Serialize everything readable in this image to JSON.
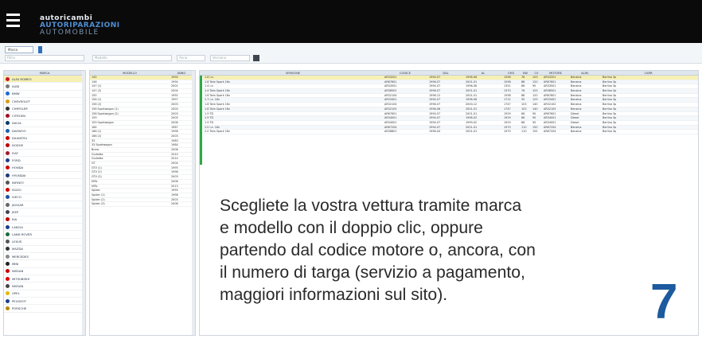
{
  "header": {
    "menu_icon": "hamburger-icon",
    "logo_line1": "autoricambi",
    "logo_line2": "AUTORIPARAZIONI",
    "logo_line3": "AUTOMOBILE"
  },
  "toolbar": {
    "selector_value": "Marca",
    "filter_brand_placeholder": "Filtra",
    "filter_model_placeholder": "Modello",
    "filter_year_placeholder": "Anno",
    "filter_version_placeholder": "Versione",
    "clear_icon": "clear-filter-icon"
  },
  "columns": {
    "brand": "MARCA",
    "model": "MODELLO",
    "year": "ANNO",
    "version": "VERSIONE",
    "code": "CODICE",
    "from": "DAL",
    "to": "AL",
    "cc": "CM3",
    "kw": "KW",
    "cv": "CV",
    "engine": "MOTORE",
    "fuel": "ALIM.",
    "body": "CARR."
  },
  "brands": [
    {
      "name": "ALFA ROMEO",
      "color": "#c8102e"
    },
    {
      "name": "AUDI",
      "color": "#777"
    },
    {
      "name": "BMW",
      "color": "#1c69d4"
    },
    {
      "name": "CHEVROLET",
      "color": "#d4a017"
    },
    {
      "name": "CHRYSLER",
      "color": "#333"
    },
    {
      "name": "CITROEN",
      "color": "#a40e26"
    },
    {
      "name": "DACIA",
      "color": "#0a3a6b"
    },
    {
      "name": "DAEWOO",
      "color": "#1b5fa8"
    },
    {
      "name": "DAIHATSU",
      "color": "#c00"
    },
    {
      "name": "DODGE",
      "color": "#b00"
    },
    {
      "name": "FIAT",
      "color": "#9b1b30"
    },
    {
      "name": "FORD",
      "color": "#1f3b8a"
    },
    {
      "name": "HONDA",
      "color": "#c00"
    },
    {
      "name": "HYUNDAI",
      "color": "#1e3a78"
    },
    {
      "name": "INFINITI",
      "color": "#555"
    },
    {
      "name": "ISUZU",
      "color": "#c00"
    },
    {
      "name": "IVECO",
      "color": "#1b4f9c"
    },
    {
      "name": "JAGUAR",
      "color": "#666"
    },
    {
      "name": "JEEP",
      "color": "#445"
    },
    {
      "name": "KIA",
      "color": "#b00"
    },
    {
      "name": "LANCIA",
      "color": "#1b3f8a"
    },
    {
      "name": "LAND ROVER",
      "color": "#1d6b3a"
    },
    {
      "name": "LEXUS",
      "color": "#555"
    },
    {
      "name": "MAZDA",
      "color": "#333"
    },
    {
      "name": "MERCEDES",
      "color": "#888"
    },
    {
      "name": "MINI",
      "color": "#222"
    },
    {
      "name": "NISSAN",
      "color": "#c00"
    },
    {
      "name": "MITSUBISHI",
      "color": "#d00"
    },
    {
      "name": "NISSAN",
      "color": "#444"
    },
    {
      "name": "OPEL",
      "color": "#e5b700"
    },
    {
      "name": "PEUGEOT",
      "color": "#1b3f8a"
    },
    {
      "name": "PORSCHE",
      "color": "#b8860b"
    }
  ],
  "models": [
    [
      "145",
      "1994"
    ],
    [
      "146",
      "1994"
    ],
    [
      "147 (1)",
      "2001"
    ],
    [
      "147 (2)",
      "2004"
    ],
    [
      "155",
      "1992"
    ],
    [
      "156 (1)",
      "1997"
    ],
    [
      "156 (2)",
      "2003"
    ],
    [
      "156 Sportwagon (1)",
      "2000"
    ],
    [
      "156 Sportwagon (2)",
      "2003"
    ],
    [
      "159",
      "2005"
    ],
    [
      "159 Sportwagon",
      "2006"
    ],
    [
      "164",
      "1987"
    ],
    [
      "166 (1)",
      "1998"
    ],
    [
      "166 (2)",
      "2003"
    ],
    [
      "33",
      "1983"
    ],
    [
      "33 Sportwagon",
      "1984"
    ],
    [
      "Brera",
      "2006"
    ],
    [
      "Giulietta",
      "2010"
    ],
    [
      "Giulietta",
      "2014"
    ],
    [
      "GT",
      "2004"
    ],
    [
      "GTV (1)",
      "1995"
    ],
    [
      "GTV (2)",
      "1998"
    ],
    [
      "GTV (3)",
      "2003"
    ],
    [
      "MiTo",
      "2008"
    ],
    [
      "MiTo",
      "2013"
    ],
    [
      "Spider",
      "1995"
    ],
    [
      "Spider (1)",
      "1998"
    ],
    [
      "Spider (2)",
      "2003"
    ],
    [
      "Spider (3)",
      "2006"
    ]
  ],
  "versions": [
    [
      "1.6 i.e.",
      "AR33201",
      "1994-07",
      "1996-06",
      "1596",
      "76",
      "103",
      "AR33201",
      "Benzina",
      "Berlina 3p"
    ],
    [
      "1.6 Twin Spark 16v",
      "AR67601",
      "1996-07",
      "2001-01",
      "1598",
      "88",
      "120",
      "AR67601",
      "Benzina",
      "Berlina 3p"
    ],
    [
      "1.4 i.e.",
      "AR33501",
      "1994-07",
      "1996-06",
      "1351",
      "66",
      "90",
      "AR33501",
      "Benzina",
      "Berlina 3p"
    ],
    [
      "1.4 Twin Spark 16v",
      "AR38501",
      "1996-07",
      "2001-01",
      "1370",
      "76",
      "103",
      "AR38501",
      "Benzina",
      "Berlina 3p"
    ],
    [
      "1.6 Twin Spark 16v",
      "AR32104",
      "1996-12",
      "2001-01",
      "1598",
      "88",
      "120",
      "AR67601",
      "Benzina",
      "Berlina 3p"
    ],
    [
      "1.7 i.e. 16v",
      "AR33401",
      "1994-07",
      "1996-06",
      "1712",
      "95",
      "129",
      "AR33401",
      "Benzina",
      "Berlina 3p"
    ],
    [
      "1.8 Twin Spark 16v",
      "AR32104",
      "1996-07",
      "2000-12",
      "1747",
      "103",
      "140",
      "AR32102",
      "Benzina",
      "Berlina 3p"
    ],
    [
      "1.8 Twin Spark 16v",
      "AR32103",
      "1996-06",
      "2001-01",
      "1747",
      "103",
      "140",
      "AR32103",
      "Benzina",
      "Berlina 3p"
    ],
    [
      "1.9 TD",
      "AR67601",
      "1994-07",
      "2001-01",
      "1929",
      "66",
      "90",
      "AR67601",
      "Diesel",
      "Berlina 3p"
    ],
    [
      "1.9 TD",
      "AR34001",
      "1994-07",
      "1998-02",
      "1929",
      "66",
      "90",
      "AR34001",
      "Diesel",
      "Berlina 3p"
    ],
    [
      "1.9 TD",
      "AR34001",
      "1994-07",
      "1999-02",
      "1929",
      "66",
      "90",
      "AR34001",
      "Diesel",
      "Berlina 3p"
    ],
    [
      "2.0 i.e. 16v",
      "AR67204",
      "1994-07",
      "2001-01",
      "1970",
      "110",
      "150",
      "AR67204",
      "Benzina",
      "Berlina 3p"
    ],
    [
      "2.0 Twin Spark 16v",
      "AR38801",
      "1998-04",
      "2001-01",
      "1970",
      "110",
      "155",
      "AR67204",
      "Benzina",
      "Berlina 3p"
    ]
  ],
  "caption_lines": [
    "Scegliete la vostra vettura tramite marca",
    "e modello con il doppio clic, oppure",
    "partendo dal codice motore o, ancora, con",
    "il numero di targa (servizio a pagamento,",
    "maggiori informazioni sul sito)."
  ],
  "page_number": "7"
}
